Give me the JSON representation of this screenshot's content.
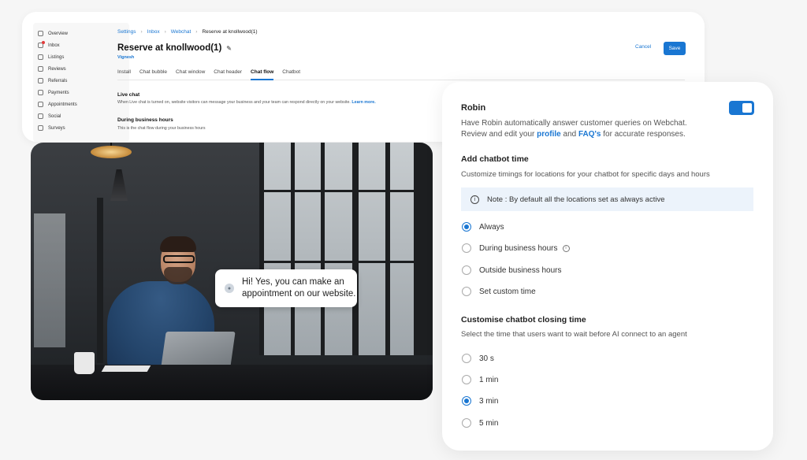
{
  "settings_page": {
    "sidebar": [
      {
        "label": "Overview",
        "icon": "home-icon"
      },
      {
        "label": "Inbox",
        "icon": "chat-icon"
      },
      {
        "label": "Listings",
        "icon": "location-icon"
      },
      {
        "label": "Reviews",
        "icon": "star-icon"
      },
      {
        "label": "Referrals",
        "icon": "referral-icon"
      },
      {
        "label": "Payments",
        "icon": "payment-icon"
      },
      {
        "label": "Appointments",
        "icon": "calendar-icon"
      },
      {
        "label": "Social",
        "icon": "social-icon"
      },
      {
        "label": "Surveys",
        "icon": "survey-icon"
      }
    ],
    "breadcrumb": {
      "items": [
        "Settings",
        "Inbox",
        "Webchat"
      ],
      "current": "Reserve at knollwood(1)",
      "separator": "›"
    },
    "title": "Reserve at knollwood(1)",
    "owner": "Vignesh",
    "cancel_label": "Cancel",
    "save_label": "Save",
    "tabs": [
      "Install",
      "Chat bubble",
      "Chat window",
      "Chat header",
      "Chat flow",
      "Chatbot"
    ],
    "active_tab": "Chat flow",
    "live_chat": {
      "heading": "Live chat",
      "description": "When Live chat is turned on, website visitors can message your business and your team can respond directly on your website.",
      "link": "Learn more."
    },
    "business_hours": {
      "heading": "During business hours",
      "description": "This is the chat flow during your business hours"
    }
  },
  "photo": {
    "bubble_text": "Hi! Yes, you can make an appointment on our website."
  },
  "robin_panel": {
    "title": "Robin",
    "toggle_on": true,
    "desc_line1": "Have Robin automatically answer customer queries on Webchat.",
    "desc_line2_pre": "Review and edit your ",
    "desc_link1": "profile",
    "desc_mid": " and ",
    "desc_link2": "FAQ's",
    "desc_post": " for accurate responses.",
    "chatbot_time": {
      "heading": "Add chatbot time",
      "subtext": "Customize timings for locations for your chatbot for specific days and hours",
      "note": "Note : By default all the locations set as always active",
      "options": [
        "Always",
        "During business hours",
        "Outside business hours",
        "Set custom time"
      ],
      "selected": "Always"
    },
    "closing_time": {
      "heading": "Customise chatbot closing time",
      "subtext": "Select the time that users want to wait before AI connect to an agent",
      "options": [
        "30 s",
        "1 min",
        "3 min",
        "5 min"
      ],
      "selected": "3 min"
    }
  },
  "colors": {
    "accent": "#1976d2",
    "note_bg": "#ecf3fb"
  }
}
